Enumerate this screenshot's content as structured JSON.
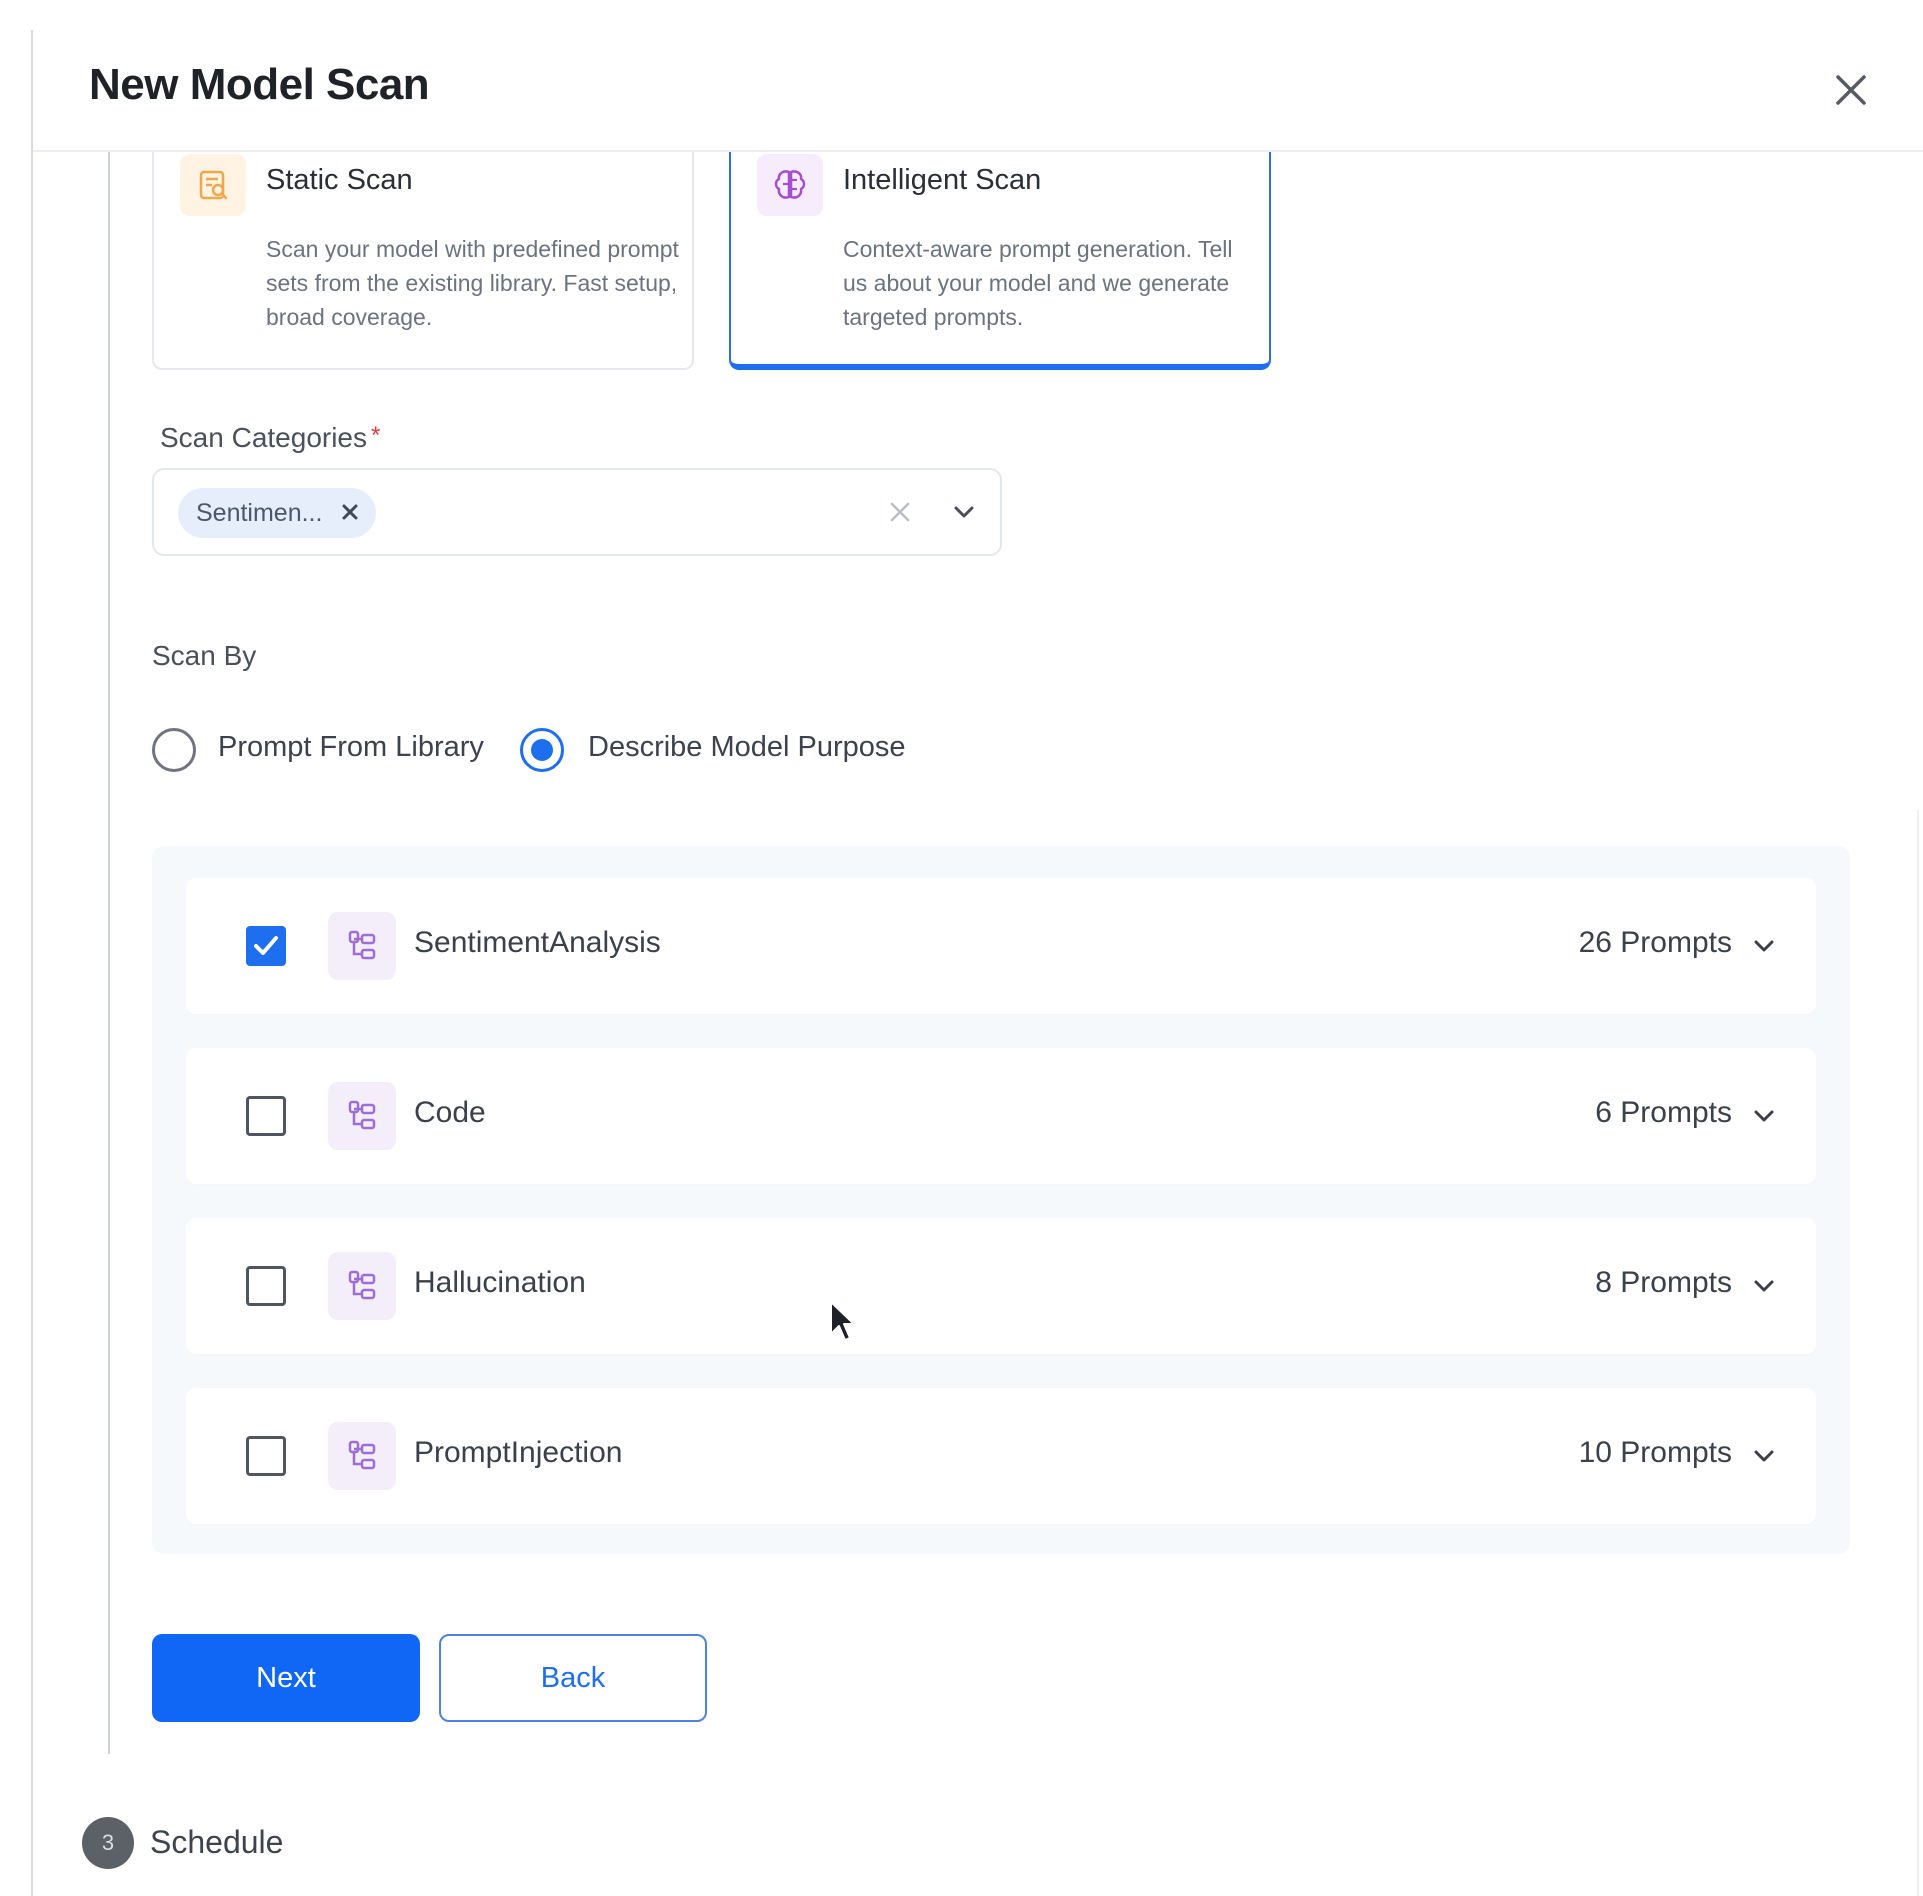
{
  "dialog": {
    "title": "New Model Scan"
  },
  "scan_types": [
    {
      "title": "Static Scan",
      "description": "Scan your model with predefined prompt sets from the existing library. Fast setup, broad coverage.",
      "icon": "file-search-icon",
      "selected": false
    },
    {
      "title": "Intelligent Scan",
      "description": "Context-aware prompt generation. Tell us about your model and we generate targeted prompts.",
      "icon": "brain-icon",
      "selected": true
    }
  ],
  "scan_categories": {
    "label": "Scan Categories",
    "required_mark": "*",
    "selected_chip": "Sentimen..."
  },
  "scan_by": {
    "label": "Scan By",
    "options": [
      {
        "label": "Prompt From Library",
        "checked": false
      },
      {
        "label": "Describe Model Purpose",
        "checked": true
      }
    ]
  },
  "categories": [
    {
      "name": "SentimentAnalysis",
      "count": "26 Prompts",
      "checked": true
    },
    {
      "name": "Code",
      "count": "6 Prompts",
      "checked": false
    },
    {
      "name": "Hallucination",
      "count": "8 Prompts",
      "checked": false
    },
    {
      "name": "PromptInjection",
      "count": "10 Prompts",
      "checked": false
    }
  ],
  "actions": {
    "next_label": "Next",
    "back_label": "Back"
  },
  "next_step": {
    "number": "3",
    "label": "Schedule"
  },
  "colors": {
    "primary": "#1066f5",
    "required": "#e03a3a",
    "static_icon_bg": "#fff3e3",
    "intelligent_icon_bg": "#f6ecfb"
  }
}
